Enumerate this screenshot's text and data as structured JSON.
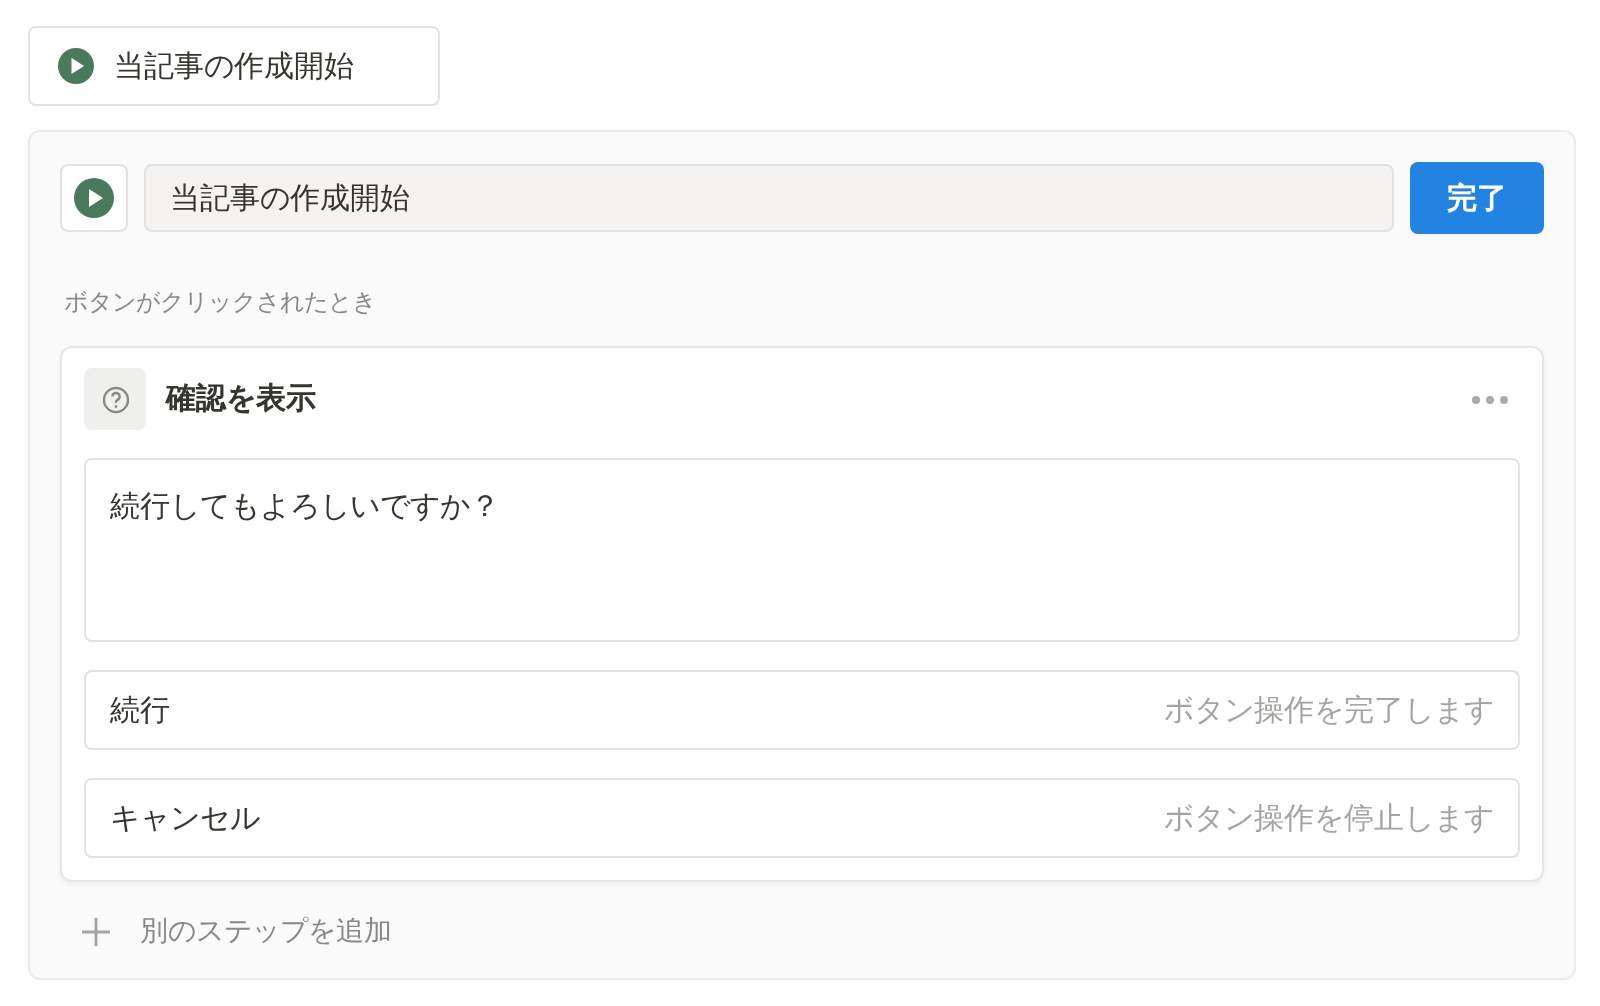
{
  "trigger_button": {
    "label": "当記事の作成開始"
  },
  "editor": {
    "name_field": {
      "value": "当記事の作成開始"
    },
    "done_button": "完了",
    "section_label": "ボタンがクリックされたとき",
    "step": {
      "title": "確認を表示",
      "message": "続行してもよろしいですか？",
      "options": [
        {
          "label": "続行",
          "hint": "ボタン操作を完了します"
        },
        {
          "label": "キャンセル",
          "hint": "ボタン操作を停止します"
        }
      ]
    },
    "add_step": "別のステップを追加"
  }
}
